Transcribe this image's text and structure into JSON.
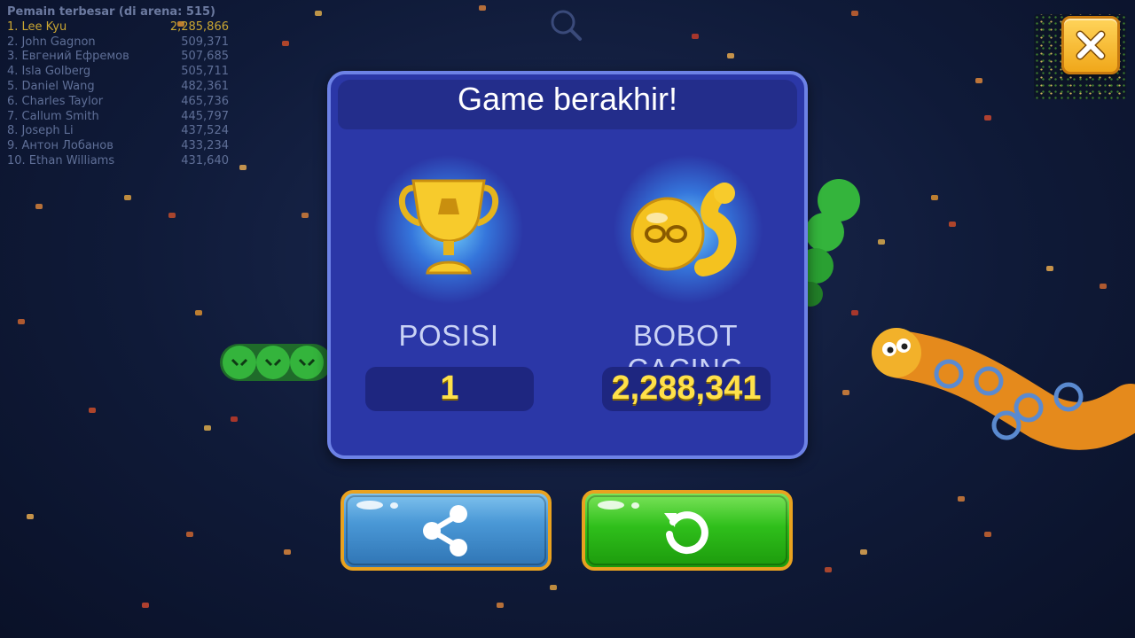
{
  "leaderboard": {
    "header": "Pemain terbesar (di arena: 515)",
    "rows": [
      {
        "name": "1. Lee Kyu",
        "score": "2,285,866"
      },
      {
        "name": "2. John Gagnon",
        "score": "509,371"
      },
      {
        "name": "3. Евгений Ефремов",
        "score": "507,685"
      },
      {
        "name": "4. Isla Golberg",
        "score": "505,711"
      },
      {
        "name": "5. Daniel Wang",
        "score": "482,361"
      },
      {
        "name": "6. Charles Taylor",
        "score": "465,736"
      },
      {
        "name": "7. Callum Smith",
        "score": "445,797"
      },
      {
        "name": "8. Joseph Li",
        "score": "437,524"
      },
      {
        "name": "9. Антон Лобанов",
        "score": "433,234"
      },
      {
        "name": "10. Ethan Williams",
        "score": "431,640"
      }
    ]
  },
  "dialog": {
    "title": "Game berakhir!",
    "position_label": "POSISI",
    "position_value": "1",
    "weight_label": "BOBOT CACING",
    "weight_value": "2,288,341"
  },
  "icons": {
    "close": "close-icon",
    "trophy": "trophy-icon",
    "worm_weight": "worm-weight-icon",
    "share": "share-icon",
    "replay": "replay-icon",
    "magnifier": "magnifier-icon"
  },
  "colors": {
    "dialog_bg": "#2b37a7",
    "dialog_border": "#6d82e6",
    "value_text": "#ffe14a",
    "share_button": "#4a98d6",
    "replay_button": "#2fbf1b",
    "button_border": "#e9a21f",
    "close_button": "#f0a71a"
  }
}
